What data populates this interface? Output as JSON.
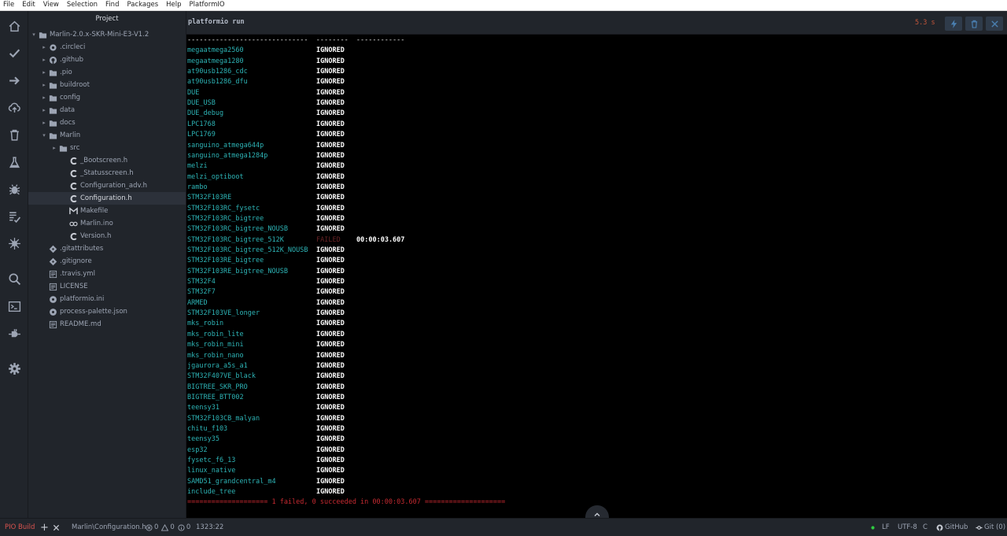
{
  "menubar": [
    "File",
    "Edit",
    "View",
    "Selection",
    "Find",
    "Packages",
    "Help",
    "PlatformIO"
  ],
  "activity_bar": [
    "home-icon",
    "check-icon",
    "arrow-right-icon",
    "cloud-upload-icon",
    "trash-icon",
    "flask-icon",
    "bug-icon",
    "checklist-icon",
    "plug-device-icon",
    "search-icon",
    "terminal-icon",
    "plug-icon",
    "gear-icon"
  ],
  "sidebar": {
    "title": "Project",
    "tree": [
      {
        "label": "Marlin-2.0.x-SKR-Mini-E3-V1.2",
        "type": "folder",
        "depth": 0,
        "expanded": true
      },
      {
        "label": ".circleci",
        "type": "folder-special",
        "depth": 1
      },
      {
        "label": ".github",
        "type": "folder-github",
        "depth": 1
      },
      {
        "label": ".pio",
        "type": "folder",
        "depth": 1
      },
      {
        "label": "buildroot",
        "type": "folder",
        "depth": 1
      },
      {
        "label": "config",
        "type": "folder",
        "depth": 1
      },
      {
        "label": "data",
        "type": "folder",
        "depth": 1
      },
      {
        "label": "docs",
        "type": "folder",
        "depth": 1
      },
      {
        "label": "Marlin",
        "type": "folder",
        "depth": 1,
        "expanded": true
      },
      {
        "label": "src",
        "type": "folder",
        "depth": 2
      },
      {
        "label": "_Bootscreen.h",
        "type": "c-file",
        "depth": 3
      },
      {
        "label": "_Statusscreen.h",
        "type": "c-file",
        "depth": 3
      },
      {
        "label": "Configuration_adv.h",
        "type": "c-file",
        "depth": 3
      },
      {
        "label": "Configuration.h",
        "type": "c-file",
        "depth": 3,
        "selected": true
      },
      {
        "label": "Makefile",
        "type": "makefile",
        "depth": 3
      },
      {
        "label": "Marlin.ino",
        "type": "ino-file",
        "depth": 3
      },
      {
        "label": "Version.h",
        "type": "c-file",
        "depth": 3
      },
      {
        "label": ".gitattributes",
        "type": "git-file",
        "depth": 1
      },
      {
        "label": ".gitignore",
        "type": "git-file",
        "depth": 1
      },
      {
        "label": ".travis.yml",
        "type": "text-file",
        "depth": 1
      },
      {
        "label": "LICENSE",
        "type": "text-file",
        "depth": 1
      },
      {
        "label": "platformio.ini",
        "type": "settings-file",
        "depth": 1
      },
      {
        "label": "process-palette.json",
        "type": "settings-file",
        "depth": 1
      },
      {
        "label": "README.md",
        "type": "text-file",
        "depth": 1
      }
    ]
  },
  "terminal": {
    "title": "platformio run",
    "elapsed": "5.3 s",
    "separator": "------------------------------  --------  ------------",
    "rows": [
      {
        "env": "megaatmega2560",
        "status": "IGNORED"
      },
      {
        "env": "megaatmega1280",
        "status": "IGNORED"
      },
      {
        "env": "at90usb1286_cdc",
        "status": "IGNORED"
      },
      {
        "env": "at90usb1286_dfu",
        "status": "IGNORED"
      },
      {
        "env": "DUE",
        "status": "IGNORED"
      },
      {
        "env": "DUE_USB",
        "status": "IGNORED"
      },
      {
        "env": "DUE_debug",
        "status": "IGNORED"
      },
      {
        "env": "LPC1768",
        "status": "IGNORED"
      },
      {
        "env": "LPC1769",
        "status": "IGNORED"
      },
      {
        "env": "sanguino_atmega644p",
        "status": "IGNORED"
      },
      {
        "env": "sanguino_atmega1284p",
        "status": "IGNORED"
      },
      {
        "env": "melzi",
        "status": "IGNORED"
      },
      {
        "env": "melzi_optiboot",
        "status": "IGNORED"
      },
      {
        "env": "rambo",
        "status": "IGNORED"
      },
      {
        "env": "STM32F103RE",
        "status": "IGNORED"
      },
      {
        "env": "STM32F103RC_fysetc",
        "status": "IGNORED"
      },
      {
        "env": "STM32F103RC_bigtree",
        "status": "IGNORED"
      },
      {
        "env": "STM32F103RC_bigtree_NOUSB",
        "status": "IGNORED"
      },
      {
        "env": "STM32F103RC_bigtree_512K",
        "status": "FAILED",
        "duration": "00:00:03.607"
      },
      {
        "env": "STM32F103RC_bigtree_512K_NOUSB",
        "status": "IGNORED"
      },
      {
        "env": "STM32F103RE_bigtree",
        "status": "IGNORED"
      },
      {
        "env": "STM32F103RE_bigtree_NOUSB",
        "status": "IGNORED"
      },
      {
        "env": "STM32F4",
        "status": "IGNORED"
      },
      {
        "env": "STM32F7",
        "status": "IGNORED"
      },
      {
        "env": "ARMED",
        "status": "IGNORED"
      },
      {
        "env": "STM32F103VE_longer",
        "status": "IGNORED"
      },
      {
        "env": "mks_robin",
        "status": "IGNORED"
      },
      {
        "env": "mks_robin_lite",
        "status": "IGNORED"
      },
      {
        "env": "mks_robin_mini",
        "status": "IGNORED"
      },
      {
        "env": "mks_robin_nano",
        "status": "IGNORED"
      },
      {
        "env": "jgaurora_a5s_a1",
        "status": "IGNORED"
      },
      {
        "env": "STM32F407VE_black",
        "status": "IGNORED"
      },
      {
        "env": "BIGTREE_SKR_PRO",
        "status": "IGNORED"
      },
      {
        "env": "BIGTREE_BTT002",
        "status": "IGNORED"
      },
      {
        "env": "teensy31",
        "status": "IGNORED"
      },
      {
        "env": "STM32F103CB_malyan",
        "status": "IGNORED"
      },
      {
        "env": "chitu_f103",
        "status": "IGNORED"
      },
      {
        "env": "teensy35",
        "status": "IGNORED"
      },
      {
        "env": "esp32",
        "status": "IGNORED"
      },
      {
        "env": "fysetc_f6_13",
        "status": "IGNORED"
      },
      {
        "env": "linux_native",
        "status": "IGNORED"
      },
      {
        "env": "SAMD51_grandcentral_m4",
        "status": "IGNORED"
      },
      {
        "env": "include_tree",
        "status": "IGNORED"
      }
    ],
    "summary": "==================== 1 failed, 0 succeeded in 00:00:03.607 ===================="
  },
  "statusbar": {
    "pio_build": "PIO Build",
    "file": "Marlin\\Configuration.h",
    "errors": "0",
    "warnings": "0",
    "infos": "0",
    "cursor": "1323:22",
    "line_ending": "LF",
    "encoding": "UTF-8",
    "grammar": "C",
    "github": "GitHub",
    "git": "Git (0)"
  },
  "colors": {
    "env_text": "#2db3b5",
    "failed_text": "#6a2326",
    "summary_text": "#c62a31",
    "elapsed_text": "#c0553a",
    "status_dot": "#2ecc40",
    "pio_build": "#c0392b"
  }
}
